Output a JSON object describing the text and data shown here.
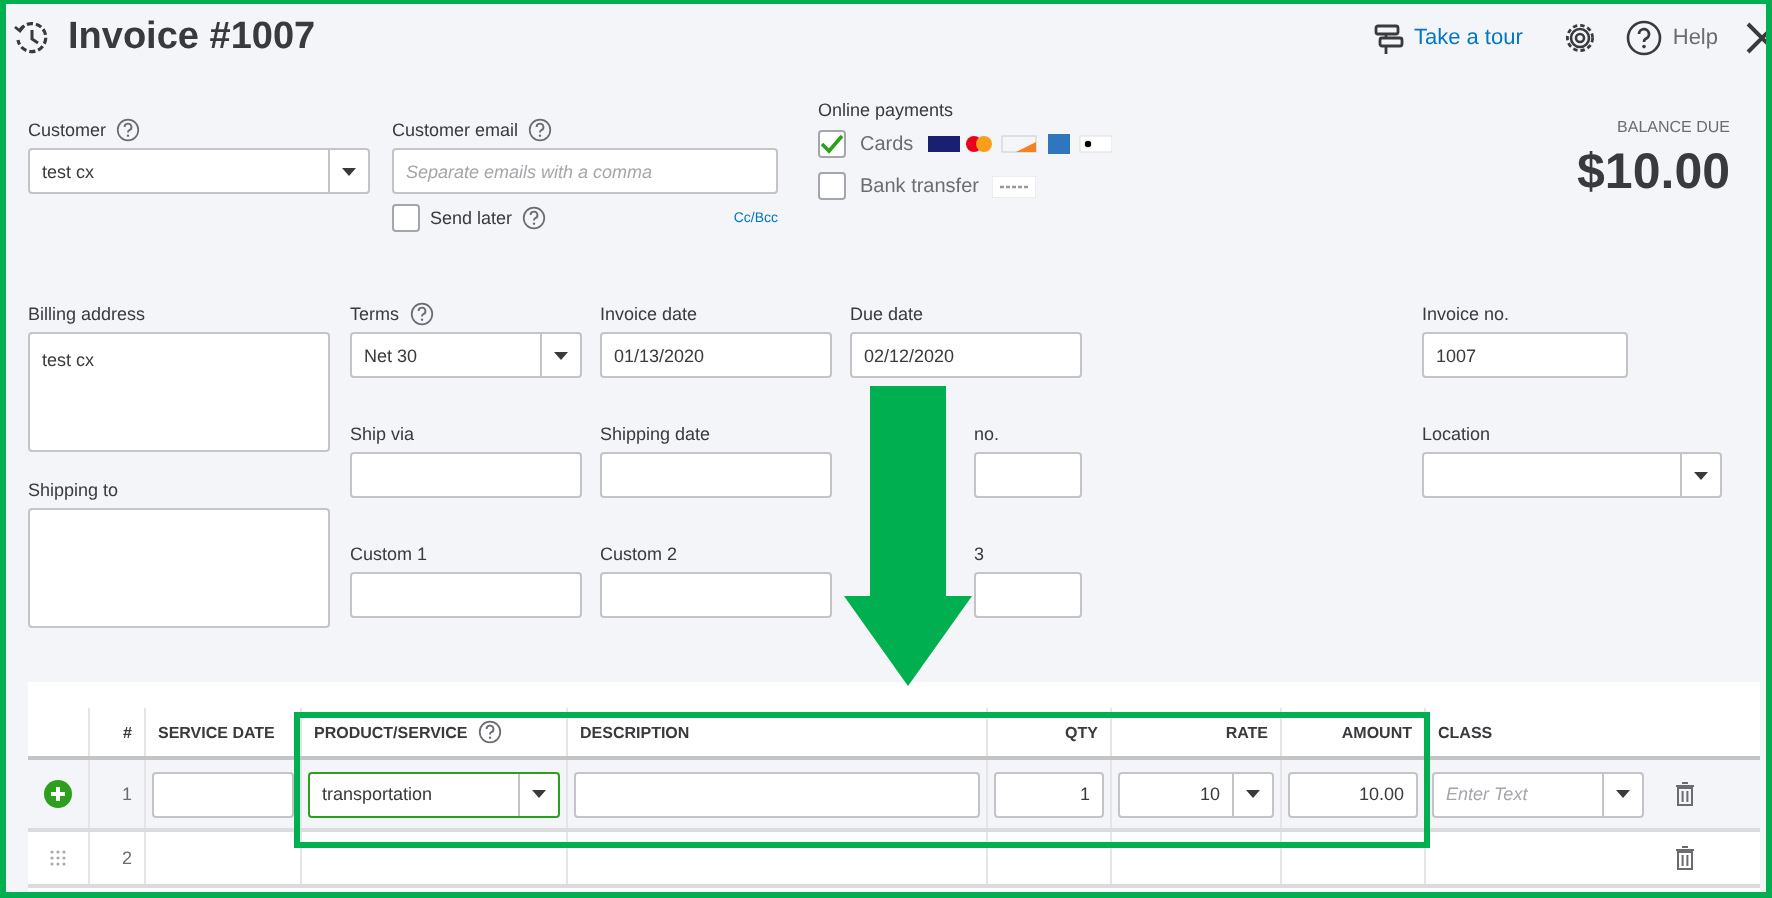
{
  "header": {
    "title": "Invoice #1007",
    "tour_link": "Take a tour",
    "help": "Help"
  },
  "customer": {
    "label": "Customer",
    "value": "test cx"
  },
  "customer_email": {
    "label": "Customer email",
    "placeholder": "Separate emails with a comma",
    "send_later": {
      "label": "Send later",
      "checked": false
    },
    "cc_bcc": "Cc/Bcc"
  },
  "online_payments": {
    "title": "Online payments",
    "options": [
      {
        "label": "Cards",
        "checked": true,
        "kind": "cards"
      },
      {
        "label": "Bank transfer",
        "checked": false,
        "kind": "bank"
      }
    ]
  },
  "balance_due": {
    "label": "BALANCE DUE",
    "amount": "$10.00"
  },
  "billing_address": {
    "label": "Billing address",
    "value": "test cx"
  },
  "shipping_to": {
    "label": "Shipping to"
  },
  "fields": [
    {
      "label": "Terms",
      "help": true,
      "kind": "select",
      "value": "Net 30",
      "label_cut": false
    },
    {
      "label": "Invoice date",
      "help": false,
      "kind": "text",
      "value": "01/13/2020",
      "label_cut": false
    },
    {
      "label": "Due date",
      "help": false,
      "kind": "text",
      "value": "02/12/2020",
      "label_cut": false
    },
    {
      "label": "Ship via",
      "help": false,
      "kind": "text",
      "label_cut": false
    },
    {
      "label": "Shipping date",
      "help": false,
      "kind": "text",
      "label_cut": false
    },
    {
      "label": "no.",
      "help": false,
      "kind": "text",
      "label_cut": true
    },
    {
      "label": "Custom 1",
      "help": false,
      "kind": "text",
      "label_cut": false
    },
    {
      "label": "Custom 2",
      "help": false,
      "kind": "text",
      "label_cut": false
    },
    {
      "label": "3",
      "help": false,
      "kind": "text",
      "label_cut": true
    }
  ],
  "right_fields": [
    {
      "label": "Invoice no.",
      "kind": "text",
      "value": "1007"
    },
    {
      "label": "Location",
      "kind": "select"
    }
  ],
  "table": {
    "columns": [
      {
        "label": "#",
        "help": false
      },
      {
        "label": "SERVICE DATE",
        "help": false
      },
      {
        "label": "PRODUCT/SERVICE",
        "help": true
      },
      {
        "label": "DESCRIPTION",
        "help": false
      },
      {
        "label": "QTY",
        "help": false
      },
      {
        "label": "RATE",
        "help": false
      },
      {
        "label": "AMOUNT",
        "help": false
      },
      {
        "label": "CLASS",
        "help": false
      }
    ],
    "rows": [
      {
        "number": "1",
        "editing": true,
        "product": "transportation",
        "qty": "1",
        "rate": "10",
        "amount": "10.00",
        "class_placeholder": "Enter Text"
      },
      {
        "number": "2",
        "editing": false
      }
    ]
  }
}
